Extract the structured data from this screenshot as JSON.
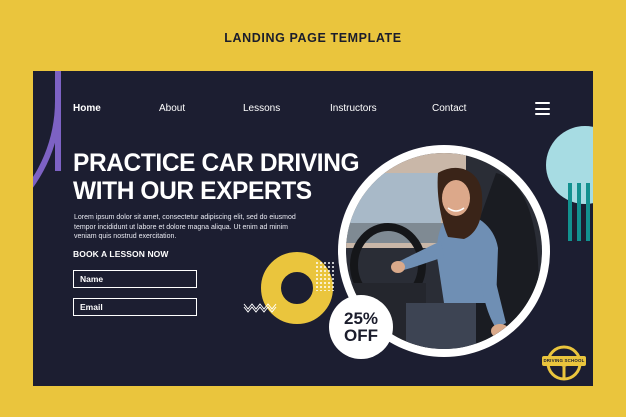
{
  "caption": "LANDING PAGE TEMPLATE",
  "nav": {
    "items": [
      "Home",
      "About",
      "Lessons",
      "Instructors",
      "Contact"
    ],
    "menu_icon": "hamburger-menu-icon"
  },
  "hero": {
    "headline_line1": "PRACTICE CAR DRIVING",
    "headline_line2": "WITH OUR EXPERTS",
    "body": "Lorem ipsum dolor sit amet, consectetur adipiscing elit, sed do eiusmod tempor incididunt ut labore et dolore magna aliqua. Ut enim ad minim veniam quis nostrud exercitation.",
    "cta": "BOOK A LESSON NOW",
    "form": {
      "name_placeholder": "Name",
      "email_placeholder": "Email"
    }
  },
  "promo": {
    "percent": "25%",
    "label": "OFF"
  },
  "logo": {
    "text": "DRIVING SCHOOL"
  },
  "colors": {
    "page_background": "#eac53d",
    "card_background": "#1c1e31",
    "accent_yellow": "#eac53d",
    "accent_purple": "#7d62c4",
    "accent_teal_light": "#a7dce3",
    "accent_teal_dark": "#12918f"
  }
}
